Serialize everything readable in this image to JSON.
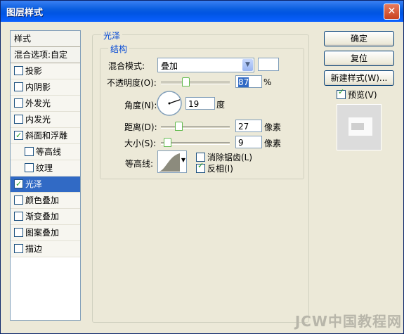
{
  "window": {
    "title": "图层样式",
    "close_label": "✕"
  },
  "style_list": {
    "header": "样式",
    "blend_options": "混合选项:自定",
    "items": [
      {
        "label": "投影",
        "checked": false,
        "indent": false,
        "selected": false
      },
      {
        "label": "内阴影",
        "checked": false,
        "indent": false,
        "selected": false
      },
      {
        "label": "外发光",
        "checked": false,
        "indent": false,
        "selected": false
      },
      {
        "label": "内发光",
        "checked": false,
        "indent": false,
        "selected": false
      },
      {
        "label": "斜面和浮雕",
        "checked": true,
        "indent": false,
        "selected": false
      },
      {
        "label": "等高线",
        "checked": false,
        "indent": true,
        "selected": false
      },
      {
        "label": "纹理",
        "checked": false,
        "indent": true,
        "selected": false
      },
      {
        "label": "光泽",
        "checked": true,
        "indent": false,
        "selected": true
      },
      {
        "label": "颜色叠加",
        "checked": false,
        "indent": false,
        "selected": false
      },
      {
        "label": "渐变叠加",
        "checked": false,
        "indent": false,
        "selected": false
      },
      {
        "label": "图案叠加",
        "checked": false,
        "indent": false,
        "selected": false
      },
      {
        "label": "描边",
        "checked": false,
        "indent": false,
        "selected": false
      }
    ]
  },
  "satin": {
    "group_title": "光泽",
    "structure_title": "结构",
    "blend_mode_label": "混合模式:",
    "blend_mode_value": "叠加",
    "blend_color": "#ffffff",
    "opacity_label": "不透明度(O):",
    "opacity_value": "87",
    "opacity_unit": "%",
    "opacity_level": 87,
    "angle_label": "角度(N):",
    "angle_value": "19",
    "angle_unit": "度",
    "distance_label": "距离(D):",
    "distance_value": "27",
    "distance_unit": "像素",
    "size_label": "大小(S):",
    "size_value": "9",
    "size_unit": "像素",
    "contour_label": "等高线:",
    "antialias_label": "消除锯齿(L)",
    "antialias_checked": false,
    "invert_label": "反相(I)",
    "invert_checked": true
  },
  "buttons": {
    "ok": "确定",
    "reset": "复位",
    "new_style": "新建样式(W)...",
    "preview_label": "预览(V)",
    "preview_checked": true
  },
  "watermark": "JCW中国教程网"
}
